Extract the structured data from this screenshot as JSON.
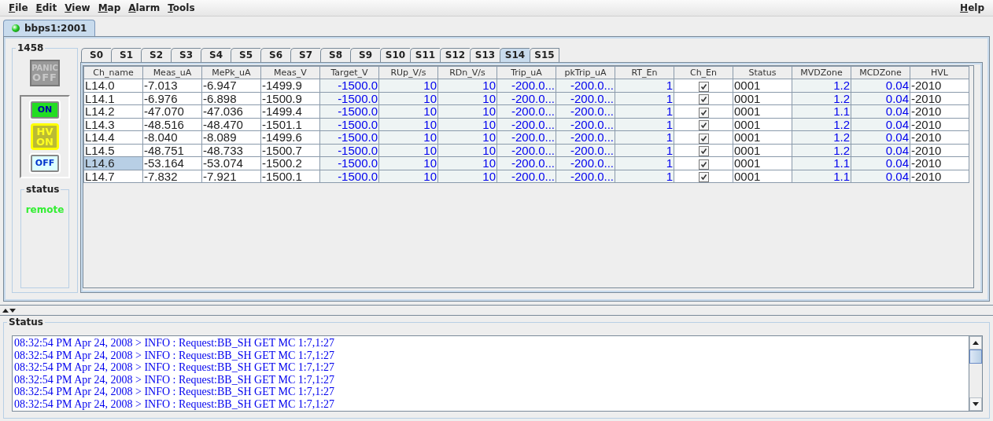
{
  "menu": {
    "left": [
      "File",
      "Edit",
      "View",
      "Map",
      "Alarm",
      "Tools"
    ],
    "right": "Help"
  },
  "doc_tab": {
    "label": "bbps1:2001",
    "connected": true
  },
  "left_panel": {
    "title": "1458",
    "panic": {
      "top": "PANIC",
      "bottom": "OFF",
      "disabled": true
    },
    "buttons": [
      {
        "kind": "on",
        "lines": [
          "ON"
        ]
      },
      {
        "kind": "hv_on",
        "lines": [
          "HV",
          "ON"
        ]
      },
      {
        "kind": "off",
        "lines": [
          "OFF"
        ]
      }
    ],
    "status_group": {
      "title": "status",
      "value": "remote"
    }
  },
  "slot_tabs": [
    {
      "label": "S0",
      "selected": false
    },
    {
      "label": "S1",
      "selected": false
    },
    {
      "label": "S2",
      "selected": false
    },
    {
      "label": "S3",
      "selected": false
    },
    {
      "label": "S4",
      "selected": false
    },
    {
      "label": "S5",
      "selected": false
    },
    {
      "label": "S6",
      "selected": false
    },
    {
      "label": "S7",
      "selected": false
    },
    {
      "label": "S8",
      "selected": false
    },
    {
      "label": "S9",
      "selected": false
    },
    {
      "label": "S10",
      "selected": false
    },
    {
      "label": "S11",
      "selected": false
    },
    {
      "label": "S12",
      "selected": false
    },
    {
      "label": "S13",
      "selected": false
    },
    {
      "label": "S14",
      "selected": true
    },
    {
      "label": "S15",
      "selected": false
    }
  ],
  "table": {
    "columns": [
      {
        "label": "Ch_name",
        "kind": "text"
      },
      {
        "label": "Meas_uA",
        "kind": "text"
      },
      {
        "label": "MePk_uA",
        "kind": "text"
      },
      {
        "label": "Meas_V",
        "kind": "text"
      },
      {
        "label": "Target_V",
        "kind": "setting"
      },
      {
        "label": "RUp_V/s",
        "kind": "setting"
      },
      {
        "label": "RDn_V/s",
        "kind": "setting"
      },
      {
        "label": "Trip_uA",
        "kind": "setting"
      },
      {
        "label": "pkTrip_uA",
        "kind": "setting"
      },
      {
        "label": "RT_En",
        "kind": "setting"
      },
      {
        "label": "Ch_En",
        "kind": "check"
      },
      {
        "label": "Status",
        "kind": "text"
      },
      {
        "label": "MVDZone",
        "kind": "setting"
      },
      {
        "label": "MCDZone",
        "kind": "setting"
      },
      {
        "label": "HVL",
        "kind": "text"
      }
    ],
    "rows": [
      {
        "selected": false,
        "cells": [
          "L14.0",
          "-7.013",
          "-6.947",
          "-1499.9",
          "-1500.0",
          "10",
          "10",
          "-200.0...",
          "-200.0...",
          "1",
          true,
          "0001",
          "1.2",
          "0.04",
          "-2010"
        ]
      },
      {
        "selected": false,
        "cells": [
          "L14.1",
          "-6.976",
          "-6.898",
          "-1500.9",
          "-1500.0",
          "10",
          "10",
          "-200.0...",
          "-200.0...",
          "1",
          true,
          "0001",
          "1.2",
          "0.04",
          "-2010"
        ]
      },
      {
        "selected": false,
        "cells": [
          "L14.2",
          "-47.070",
          "-47.036",
          "-1499.4",
          "-1500.0",
          "10",
          "10",
          "-200.0...",
          "-200.0...",
          "1",
          true,
          "0001",
          "1.1",
          "0.04",
          "-2010"
        ]
      },
      {
        "selected": false,
        "cells": [
          "L14.3",
          "-48.516",
          "-48.470",
          "-1501.1",
          "-1500.0",
          "10",
          "10",
          "-200.0...",
          "-200.0...",
          "1",
          true,
          "0001",
          "1.2",
          "0.04",
          "-2010"
        ]
      },
      {
        "selected": false,
        "cells": [
          "L14.4",
          "-8.040",
          "-8.089",
          "-1499.6",
          "-1500.0",
          "10",
          "10",
          "-200.0...",
          "-200.0...",
          "1",
          true,
          "0001",
          "1.2",
          "0.04",
          "-2010"
        ]
      },
      {
        "selected": false,
        "cells": [
          "L14.5",
          "-48.751",
          "-48.733",
          "-1500.7",
          "-1500.0",
          "10",
          "10",
          "-200.0...",
          "-200.0...",
          "1",
          true,
          "0001",
          "1.2",
          "0.04",
          "-2010"
        ]
      },
      {
        "selected": true,
        "cells": [
          "L14.6",
          "-53.164",
          "-53.074",
          "-1500.2",
          "-1500.0",
          "10",
          "10",
          "-200.0...",
          "-200.0...",
          "1",
          true,
          "0001",
          "1.1",
          "0.04",
          "-2010"
        ]
      },
      {
        "selected": false,
        "cells": [
          "L14.7",
          "-7.832",
          "-7.921",
          "-1500.1",
          "-1500.0",
          "10",
          "10",
          "-200.0...",
          "-200.0...",
          "1",
          true,
          "0001",
          "1.1",
          "0.04",
          "-2010"
        ]
      }
    ]
  },
  "status_panel": {
    "title": "Status",
    "log": [
      "08:32:54 PM Apr 24, 2008 > INFO : Request:BB_SH GET MC 1:7,1:27",
      "08:32:54 PM Apr 24, 2008 > INFO : Request:BB_SH GET MC 1:7,1:27",
      "08:32:54 PM Apr 24, 2008 > INFO : Request:BB_SH GET MC 1:7,1:27",
      "08:32:54 PM Apr 24, 2008 > INFO : Request:BB_SH GET MC 1:7,1:27",
      "08:32:54 PM Apr 24, 2008 > INFO : Request:BB_SH GET MC 1:7,1:27",
      "08:32:54 PM Apr 24, 2008 > INFO : Request:BB_SH GET MC 1:7,1:27"
    ]
  }
}
